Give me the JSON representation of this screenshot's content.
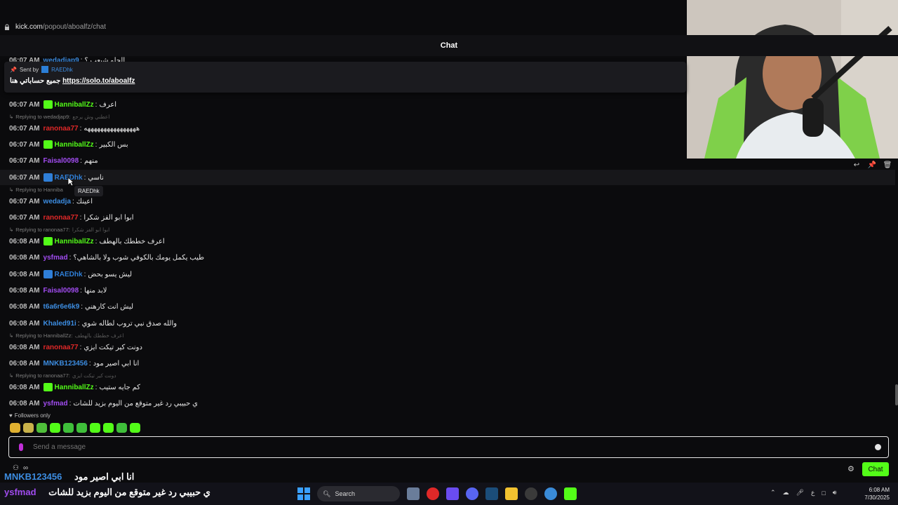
{
  "browser": {
    "host": "kick.com",
    "path": "/popout/aboalfz/chat"
  },
  "header": {
    "title": "Chat"
  },
  "pinned": {
    "sent_by_label": "Sent by",
    "sender": "RAEDhk",
    "text": "جميع حساباتي هنا",
    "link": "https://solo.to/aboalfz"
  },
  "partial_top": {
    "time": "06:07 AM",
    "user": "wedadjap9",
    "text": "الحلو شبعب ؟"
  },
  "messages": [
    {
      "time": "06:07 AM",
      "user": "HanniballZz",
      "color": "#53fc18",
      "badge": true,
      "text": "اعرف"
    },
    {
      "reply": true,
      "to": "Replying to wedadjap9:",
      "quote": "اعطني وش يرجع"
    },
    {
      "time": "06:07 AM",
      "user": "ranonaa77",
      "color": "#e02828",
      "badge": false,
      "text": "ههههههههههههههههه"
    },
    {
      "time": "06:07 AM",
      "user": "HanniballZz",
      "color": "#53fc18",
      "badge": true,
      "text": "بس الكبير"
    },
    {
      "time": "06:07 AM",
      "user": "Faisal0098",
      "color": "#a14cf0",
      "badge": false,
      "text": "منهم"
    },
    {
      "time": "06:07 AM",
      "user": "RAEDhk",
      "color": "#2f7fd8",
      "badge": true,
      "text": "ناسي",
      "hover": true
    },
    {
      "reply": true,
      "to": "Replying to Hanniba",
      "quote": ""
    },
    {
      "time": "06:07 AM",
      "user": "wedadja",
      "color": "#3c8ce0",
      "badge": false,
      "text": "اعينك"
    },
    {
      "time": "06:07 AM",
      "user": "ranonaa77",
      "color": "#e02828",
      "badge": false,
      "text": "ابوا ابو الفز شكرا"
    },
    {
      "reply": true,
      "to": "Replying to ranonaa77:",
      "quote": "ابوا ابو الفز شكرا"
    },
    {
      "time": "06:08 AM",
      "user": "HanniballZz",
      "color": "#53fc18",
      "badge": true,
      "text": "اعرف خططك بالهطف"
    },
    {
      "time": "06:08 AM",
      "user": "ysfmad",
      "color": "#a14cf0",
      "badge": false,
      "text": "طيب يكمل يومك بالكوفي شوب ولا بالشاهي؟"
    },
    {
      "time": "06:08 AM",
      "user": "RAEDhk",
      "color": "#2f7fd8",
      "badge": true,
      "text": "ليش يسو بحض"
    },
    {
      "time": "06:08 AM",
      "user": "Faisal0098",
      "color": "#a14cf0",
      "badge": false,
      "text": "لابد منها"
    },
    {
      "time": "06:08 AM",
      "user": "t6a6r6e6k9",
      "color": "#3c8ce0",
      "badge": false,
      "text": "ليش انت كارهني"
    },
    {
      "time": "06:08 AM",
      "user": "Khaled91i",
      "color": "#3c8ce0",
      "badge": false,
      "text": "والله صدق نبي تروب لطاله شوي"
    },
    {
      "reply": true,
      "to": "Replying to HanniballZz:",
      "quote": "اعرف خططك بالهطف"
    },
    {
      "time": "06:08 AM",
      "user": "ranonaa77",
      "color": "#e02828",
      "badge": false,
      "text": "دونت كير تيكت ايزي"
    },
    {
      "time": "06:08 AM",
      "user": "MNKB123456",
      "color": "#3c8ce0",
      "badge": false,
      "text": "انا ابي اصير مود"
    },
    {
      "reply": true,
      "to": "Replying to ranonaa77:",
      "quote": "دونت كير تيكت ايزي"
    },
    {
      "time": "06:08 AM",
      "user": "HanniballZz",
      "color": "#53fc18",
      "badge": true,
      "text": "كم جايه ستيب"
    },
    {
      "time": "06:08 AM",
      "user": "ysfmad",
      "color": "#a14cf0",
      "badge": false,
      "text": "ي حبيبي رد غير متوقع من اليوم بزيد للشات"
    }
  ],
  "tooltip": "RAEDhk",
  "followers_only": "Followers only",
  "input": {
    "placeholder": "Send a message"
  },
  "chat_button": "Chat",
  "overlay": {
    "line1_user": "MNKB123456",
    "line1_text": "انا ابي اصير مود",
    "line2_user": "ysfmad",
    "line2_text": "ي حبيبي رد غير متوقع من اليوم بزيد للشات"
  },
  "taskbar": {
    "search_label": "Search",
    "tray_lang": "ع",
    "time": "6:08 AM",
    "date": "7/30/2025"
  },
  "colors": {
    "kick_green": "#53fc18",
    "bg": "#0b0b0d"
  }
}
